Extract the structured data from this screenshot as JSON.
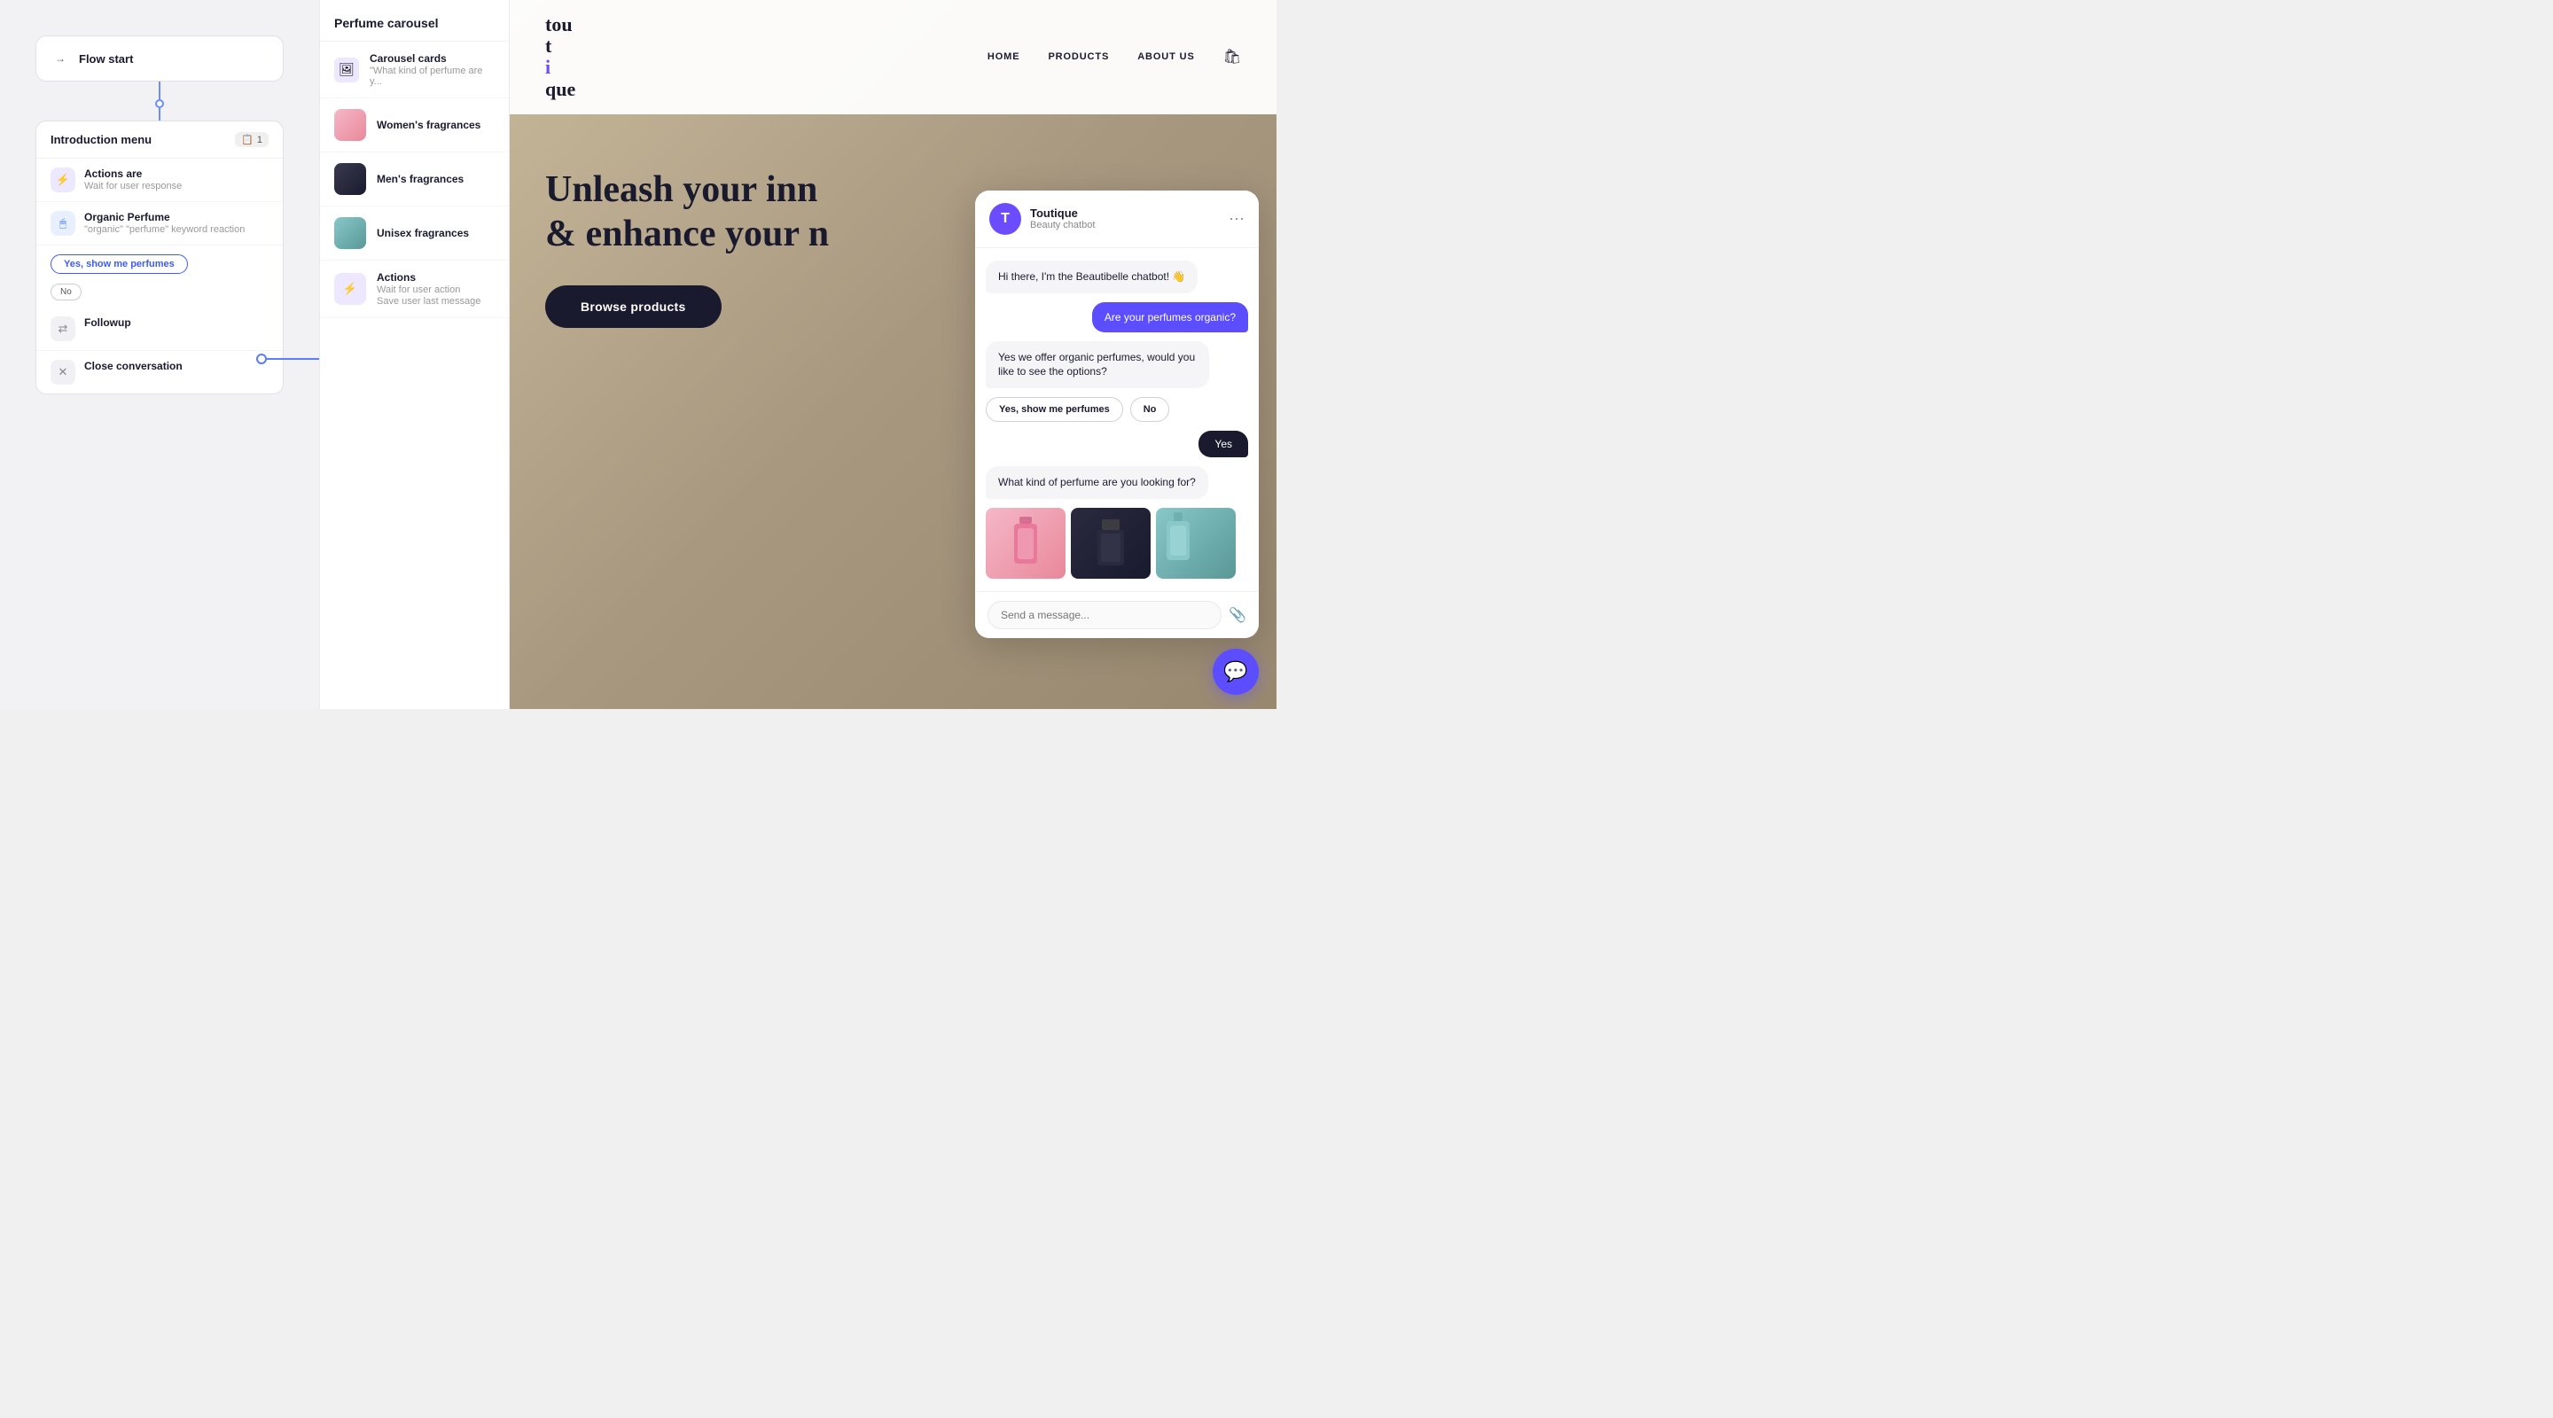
{
  "flow": {
    "flow_start": {
      "label": "Flow start",
      "icon": "→"
    },
    "intro_menu": {
      "title": "Introduction menu",
      "badge": "1",
      "actions_are": {
        "title": "Actions are",
        "subtitle": "Wait for user response"
      },
      "organic_perfume": {
        "title": "Organic Perfume",
        "subtitle": "\"organic\" \"perfume\" keyword reaction"
      },
      "yes_button": "Yes, show me perfumes",
      "no_button": "No",
      "followup": {
        "title": "Followup"
      },
      "close_conversation": {
        "title": "Close conversation"
      }
    },
    "perfume_carousel": {
      "title": "Perfume carousel",
      "items": [
        {
          "label": "Carousel cards",
          "sublabel": "\"What kind of perfume are y...",
          "type": "carousel"
        },
        {
          "label": "Women's fragrances",
          "type": "women"
        },
        {
          "label": "Men's fragrances",
          "type": "men"
        },
        {
          "label": "Unisex fragrances",
          "type": "unisex"
        },
        {
          "label": "Actions",
          "sublabel": "Wait for user action\nSave user last message",
          "type": "actions"
        }
      ]
    }
  },
  "website": {
    "logo_line1": "tou",
    "logo_line2": "tique",
    "nav": {
      "home": "HOME",
      "products": "PRODUCTS",
      "about_us": "ABOUT US"
    },
    "hero_title_line1": "Unleash your inn",
    "hero_title_line2": "& enhance your n",
    "browse_button": "Browse products"
  },
  "chatbot": {
    "name": "Toutique",
    "subtitle": "Beauty chatbot",
    "avatar_letter": "T",
    "messages": [
      {
        "type": "bot",
        "text": "Hi there, I'm the Beautibelle chatbot! 👋"
      },
      {
        "type": "user",
        "text": "Are your perfumes organic?"
      },
      {
        "type": "bot",
        "text": "Yes we offer organic perfumes, would you like to see the options?"
      },
      {
        "type": "buttons",
        "options": [
          "Yes, show me perfumes",
          "No"
        ]
      },
      {
        "type": "user",
        "text": "Yes"
      },
      {
        "type": "bot",
        "text": "What kind of perfume are you looking for?"
      },
      {
        "type": "images"
      }
    ],
    "input_placeholder": "Send a message..."
  }
}
